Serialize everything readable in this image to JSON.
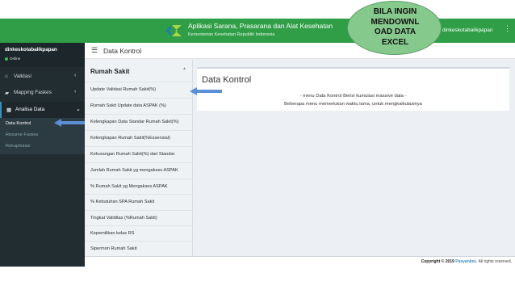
{
  "header": {
    "app_title": "Aplikasi Sarana, Prasarana dan Alat Kesehatan",
    "app_subtitle": "Kementerian Kesehatan Republik Indonesia",
    "username": "dinkeskotabalikpapan",
    "logo_icon": "kemenkes-logo-icon",
    "menu_icon": "kebab-menu-icon",
    "brand_color": "#2f9e47"
  },
  "sidebar": {
    "user_name": "dinkeskotabalikpapan",
    "user_status": "Online",
    "items": [
      {
        "label": "Validasi",
        "icon": "home-icon"
      },
      {
        "label": "Mapping Faskes",
        "icon": "car-icon"
      },
      {
        "label": "Analisa Data",
        "icon": "table-icon"
      }
    ],
    "submenu": [
      {
        "label": "Data Kontrol"
      },
      {
        "label": "Resume Faskes"
      },
      {
        "label": "Rekapitulasi"
      }
    ]
  },
  "content_header": {
    "title": "Data Kontrol"
  },
  "rs_panel": {
    "title": "Rumah Sakit",
    "items": [
      "Update Validasi Rumah Sakit(%)",
      "Rumah Sakit Update data ASPAK (%)",
      "Kelengkapan Data Standar Rumah Sakit(%)",
      "Kelengkapan Rumah Sakit(%Essensial)",
      "Kekurangan Rumah Sakit(%) dari Standar",
      "Jumlah Rumah Sakit yg mengakses ASPAK",
      "% Rumah Sakit yg Mengakses ASPAK",
      "% Kebutuhan SPA Rumah Sakit",
      "Tingkat Validitas (%Rumah Sakit)",
      "Kepemilikan kelas RS",
      "Sipermon Rumah Sakit"
    ]
  },
  "box": {
    "title": "Data Kontrol",
    "line1": "- menu Data Kontrol Berisi kumulasi massive data -",
    "line2": "Beberapa menu memerlukan waktu lama, untuk mengkalkulasinya"
  },
  "annotation": {
    "lines": [
      "BILA INGIN",
      "MENDOWNL",
      "OAD DATA",
      "EXCEL"
    ]
  },
  "footer": {
    "copyright": "Copyright © 2019",
    "brand": "Pasyankes",
    "rights": ". All rights reserved."
  }
}
